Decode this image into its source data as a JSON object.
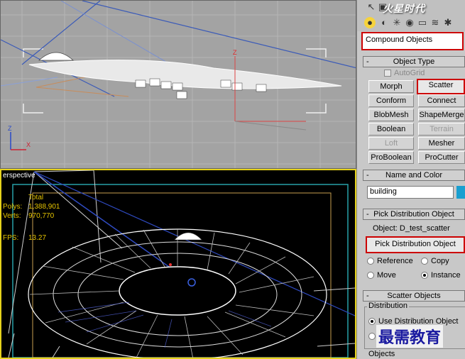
{
  "viewports": {
    "top": {
      "axis_z": "Z",
      "axis_x": "X",
      "axis_gizmo_z": "Z"
    },
    "perspective": {
      "label": "erspective",
      "stats": {
        "header": "Total",
        "polys_label": "Polys:",
        "polys_value": "1,388,901",
        "verts_label": "Verts:",
        "verts_value": "970,770",
        "fps_label": "FPS:",
        "fps_value": "13.27"
      }
    }
  },
  "panel": {
    "logo": "火星时代",
    "category_dropdown": "Compound Objects",
    "object_type": {
      "header": "Object Type",
      "autogrid": "AutoGrid",
      "buttons": [
        "Morph",
        "Scatter",
        "Conform",
        "Connect",
        "BlobMesh",
        "ShapeMerge",
        "Boolean",
        "Terrain",
        "Loft",
        "Mesher",
        "ProBoolean",
        "ProCutter"
      ]
    },
    "name_color": {
      "header": "Name and Color",
      "name_value": "building",
      "color": "#1a9fd0"
    },
    "pick_distribution": {
      "header": "Pick Distribution Object",
      "object_label": "Object: D_test_scatter",
      "button": "Pick Distribution Object",
      "radio_reference": "Reference",
      "radio_copy": "Copy",
      "radio_move": "Move",
      "radio_instance": "Instance"
    },
    "scatter_objects": {
      "header": "Scatter Objects",
      "distribution_label": "Distribution",
      "use_distribution": "Use Distribution Object",
      "objects_label": "Objects"
    }
  },
  "watermark": "最需教育",
  "colors": {
    "highlight": "#cc0000",
    "active_viewport": "#e6d21c",
    "stats_text": "#e6c400"
  }
}
